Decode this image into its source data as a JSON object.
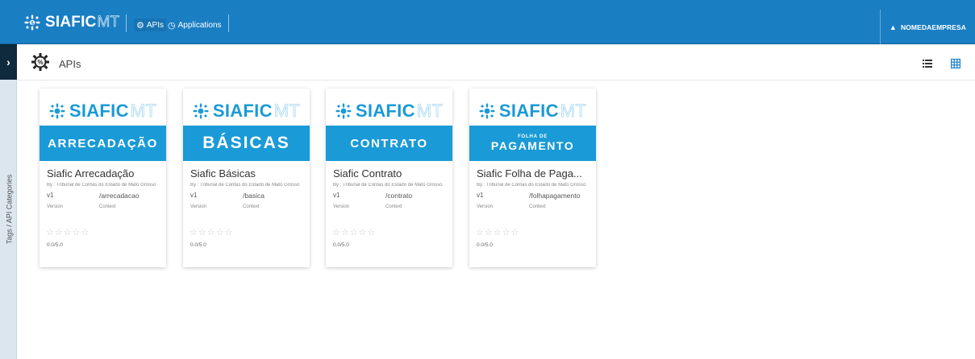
{
  "brand": {
    "name": "SIAFIC",
    "suffix": "MT",
    "color": "#1a7ec3",
    "accent": "#1a9ad6"
  },
  "nav": {
    "apis": {
      "label": "APIs",
      "icon": "gear-icon"
    },
    "applications": {
      "label": "Applications",
      "icon": "gauge-icon"
    }
  },
  "user": {
    "name": "NOMEDAEMPRESA",
    "icon": "user-icon"
  },
  "sidebar": {
    "label": "Tags / API Categories",
    "toggle": "›"
  },
  "page": {
    "title": "APIs"
  },
  "cards": [
    {
      "banner": "ARRECADAÇÃO",
      "name": "Siafic Arrecadação",
      "by": "By : Tribunal de Contas do Estado de Mato Grosso",
      "version": "v1",
      "version_label": "Version",
      "context": "/arrecadacao",
      "context_label": "Context",
      "stars": "☆☆☆☆☆",
      "rating": "0.0/5.0"
    },
    {
      "banner": "BÁSICAS",
      "name": "Siafic Básicas",
      "by": "By : Tribunal de Contas do Estado de Mato Grosso",
      "version": "v1",
      "version_label": "Version",
      "context": "/basica",
      "context_label": "Context",
      "stars": "☆☆☆☆☆",
      "rating": "0.0/5.0"
    },
    {
      "banner": "CONTRATO",
      "name": "Siafic Contrato",
      "by": "By : Tribunal de Contas do Estado de Mato Grosso",
      "version": "v1",
      "version_label": "Version",
      "context": "/contrato",
      "context_label": "Context",
      "stars": "☆☆☆☆☆",
      "rating": "0.0/5.0"
    },
    {
      "banner_top": "FOLHA DE",
      "banner": "PAGAMENTO",
      "name": "Siafic Folha de Paga...",
      "by": "By : Tribunal de Contas do Estado de Mato Grosso",
      "version": "v1",
      "version_label": "Version",
      "context": "/folhapagamento",
      "context_label": "Context",
      "stars": "☆☆☆☆☆",
      "rating": "0.0/5.0"
    }
  ]
}
